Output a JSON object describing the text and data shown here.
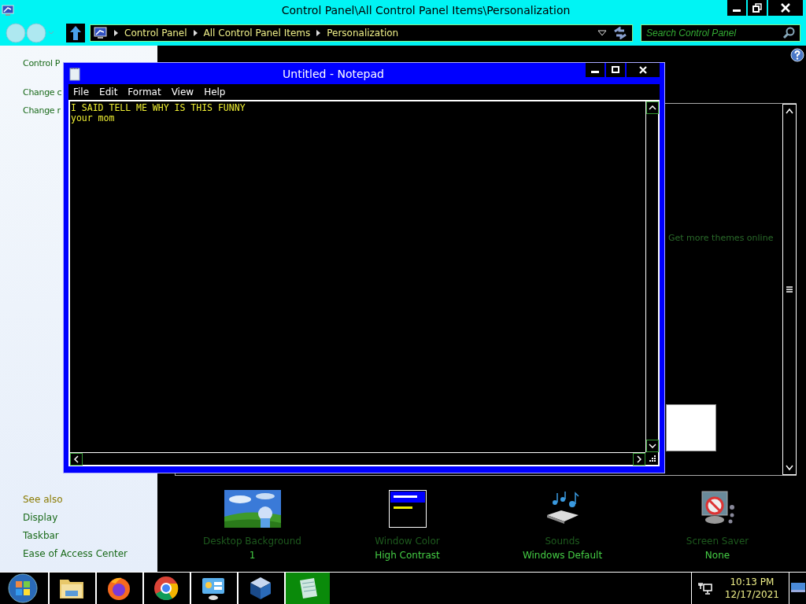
{
  "window": {
    "title": "Control Panel\\All Control Panel Items\\Personalization"
  },
  "address_bar": {
    "breadcrumbs": [
      "Control Panel",
      "All Control Panel Items",
      "Personalization"
    ]
  },
  "search": {
    "placeholder": "Search Control Panel"
  },
  "sidebar": {
    "links": [
      "Control P",
      "Change c",
      "Change r"
    ],
    "see_also_heading": "See also",
    "see_also": [
      "Display",
      "Taskbar",
      "Ease of Access Center"
    ]
  },
  "themes": {
    "online_link": "Get more themes online"
  },
  "settings": [
    {
      "kind": "background",
      "label": "Desktop Background",
      "value": "1"
    },
    {
      "kind": "color",
      "label": "Window Color",
      "value": "High Contrast"
    },
    {
      "kind": "sounds",
      "label": "Sounds",
      "value": "Windows Default"
    },
    {
      "kind": "screensaver",
      "label": "Screen Saver",
      "value": "None"
    }
  ],
  "notepad": {
    "title": "Untitled - Notepad",
    "menu": [
      "File",
      "Edit",
      "Format",
      "View",
      "Help"
    ],
    "lines": [
      "I SAID TELL ME WHY IS THIS FUNNY",
      "your mom"
    ]
  },
  "taskbar": {
    "apps": [
      {
        "kind": "explorer",
        "selected": false
      },
      {
        "kind": "firefox",
        "selected": false
      },
      {
        "kind": "chrome",
        "selected": false
      },
      {
        "kind": "controlpanel",
        "selected": false
      },
      {
        "kind": "virtualbox",
        "selected": false
      },
      {
        "kind": "notepad",
        "selected": true
      }
    ],
    "time": "10:13 PM",
    "date": "12/17/2021"
  }
}
